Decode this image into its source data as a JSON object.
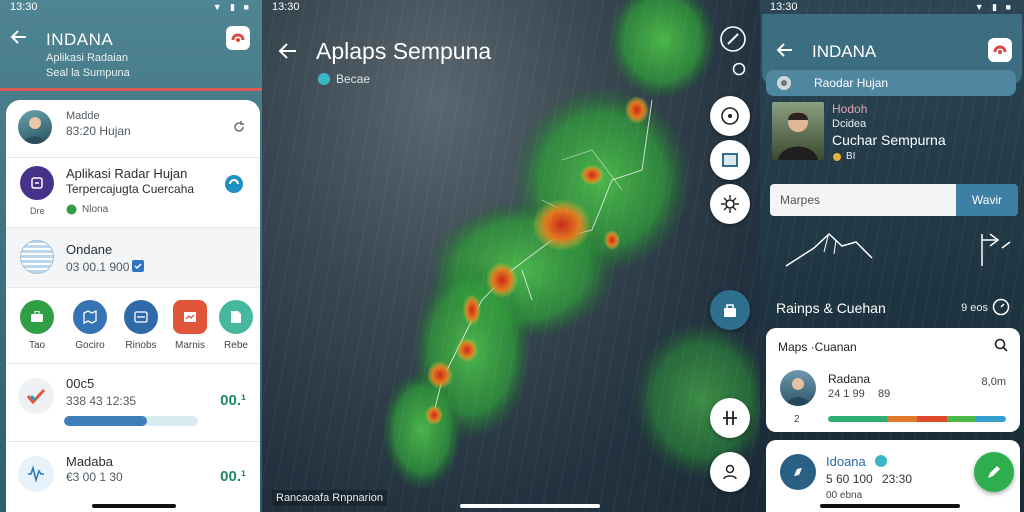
{
  "colors": {
    "teal_header": "#4f8492",
    "accent_blue": "#3f7fb8",
    "radar_green": "#2f9a3a",
    "radar_red": "#c72a1a",
    "fab_green": "#2fae4e"
  },
  "status": {
    "time": "13:30"
  },
  "panel1": {
    "header": {
      "title": "INDANA",
      "line1": "Aplikasi Radaian",
      "line2": "Seal la Sumpuna"
    },
    "contact": {
      "name": "Madde",
      "detail": "83:20 Hujan"
    },
    "app": {
      "title": "Aplikasi Radar Hujan",
      "subtitle": "Terpercajugta Cuercaha",
      "meta_left": "Dre",
      "meta_right": "Nlona"
    },
    "location": {
      "name": "Ondane",
      "value": "03 00.1 900"
    },
    "shortcuts": [
      {
        "label": "Tao",
        "icon": "briefcase-icon",
        "color": "#2f9e44"
      },
      {
        "label": "Gociro",
        "icon": "map-icon",
        "color": "#3574b4"
      },
      {
        "label": "Rinobs",
        "icon": "list-icon",
        "color": "#2f6aa8"
      },
      {
        "label": "Marnis",
        "icon": "chart-icon",
        "color": "#e1553a"
      },
      {
        "label": "Rebe",
        "icon": "note-icon",
        "color": "#45b89e"
      }
    ],
    "list": [
      {
        "name": "00c5",
        "detail": "338 43 12:35",
        "value": "00.¹",
        "progress": 0.62
      },
      {
        "name": "Madaba",
        "detail": "€3 00 1 30",
        "value": "00.¹"
      }
    ]
  },
  "panel2": {
    "title": "Aplaps Sempuna",
    "subtitle": "Becae",
    "caption": "Rancaoafa Rnpnarion",
    "buttons": [
      "edit-icon",
      "location-icon",
      "layers-icon",
      "settings-icon",
      "share-icon",
      "grid-icon",
      "profile-icon"
    ]
  },
  "panel3": {
    "header": {
      "title": "INDANA"
    },
    "radar_row": "Raodar Hujan",
    "profile": {
      "line1": "Hodoh",
      "line2": "Dcidea",
      "line3": "Cuchar Sempurna",
      "line4": "BI"
    },
    "search": {
      "placeholder": "Marpes",
      "button": "Wavir"
    },
    "section": {
      "title": "Rainps & Cuehan",
      "count": "9 eos"
    },
    "card": {
      "header": "Maps ·Cuanan",
      "item": {
        "name": "Radana",
        "detail": "24 1 99",
        "extra": "89",
        "value": "8,0m",
        "footer": "2"
      }
    },
    "bottom": {
      "name": "Idoana",
      "detail1": "5 60 100",
      "detail2": "23:30",
      "sub": "00 ebna"
    }
  }
}
